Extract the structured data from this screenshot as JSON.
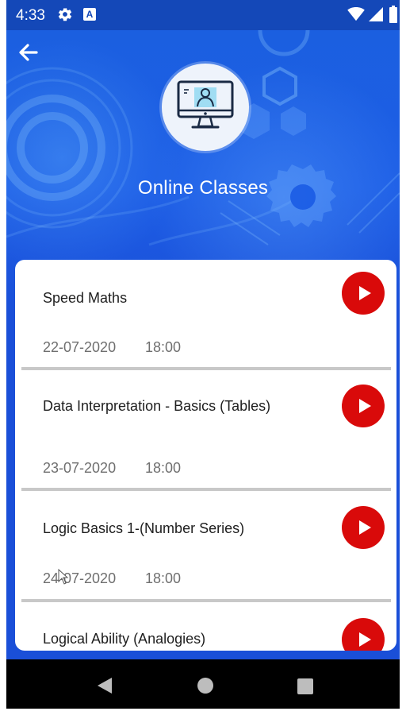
{
  "status_bar": {
    "time": "4:33",
    "icons": [
      "gear-icon",
      "a-notification-icon",
      "wifi-icon",
      "signal-icon",
      "battery-icon"
    ],
    "notification_letter": "A"
  },
  "header": {
    "back_icon": "arrow-left-icon",
    "logo_icon": "online-class-monitor-icon",
    "title": "Online Classes"
  },
  "classes": [
    {
      "title": "Speed Maths",
      "date": "22-07-2020",
      "time": "18:00"
    },
    {
      "title": "Data Interpretation - Basics (Tables)",
      "date": "23-07-2020",
      "time": "18:00"
    },
    {
      "title": "Logic Basics 1-(Number Series)",
      "date": "24-07-2020",
      "time": "18:00"
    },
    {
      "title": "Logical Ability (Analogies)",
      "date": "",
      "time": ""
    }
  ],
  "colors": {
    "header_blue": "#1a4fd8",
    "play_red": "#d90a0a",
    "title_text": "#1e1e1e",
    "meta_text": "#6f6f6f"
  },
  "nav_bar": {
    "icons": [
      "back-triangle-icon",
      "home-circle-icon",
      "recents-square-icon"
    ]
  }
}
